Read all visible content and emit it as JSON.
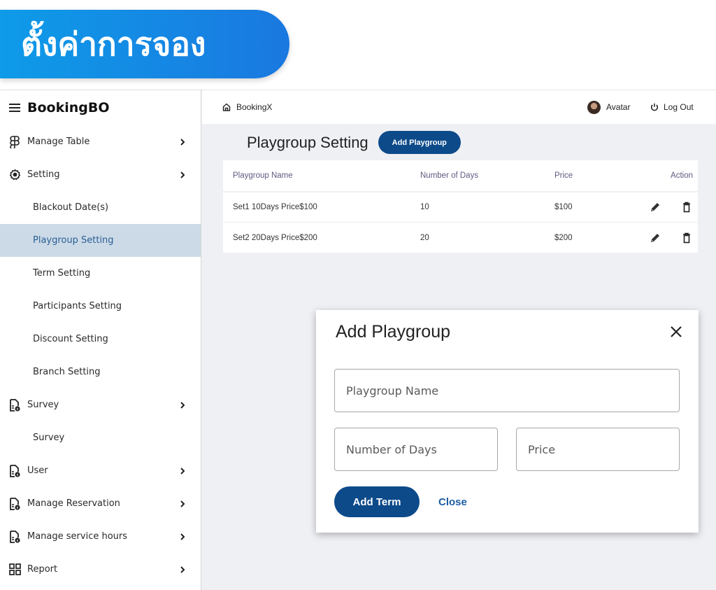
{
  "banner": {
    "title": "ตั้งค่าการจอง"
  },
  "sidebar": {
    "brand": "BookingBO",
    "items": [
      {
        "label": "Manage Table",
        "icon": "figma-icon",
        "level": "top",
        "chevron": true
      },
      {
        "label": "Setting",
        "icon": "gear-icon",
        "level": "top",
        "chevron": true
      },
      {
        "label": "Blackout Date(s)",
        "level": "sub"
      },
      {
        "label": "Playgroup Setting",
        "level": "sub",
        "active": true
      },
      {
        "label": "Term Setting",
        "level": "sub"
      },
      {
        "label": "Participants Setting",
        "level": "sub"
      },
      {
        "label": "Discount Setting",
        "level": "sub"
      },
      {
        "label": "Branch Setting",
        "level": "sub"
      },
      {
        "label": "Survey",
        "icon": "document-info-icon",
        "level": "top",
        "chevron": true
      },
      {
        "label": "Survey",
        "level": "sub"
      },
      {
        "label": "User",
        "icon": "document-info-icon",
        "level": "top",
        "chevron": true
      },
      {
        "label": "Manage Reservation",
        "icon": "document-info-icon",
        "level": "top",
        "chevron": true
      },
      {
        "label": "Manage service hours",
        "icon": "document-info-icon",
        "level": "top",
        "chevron": true
      },
      {
        "label": "Report",
        "icon": "grid-icon",
        "level": "top",
        "chevron": true
      }
    ]
  },
  "topbar": {
    "breadcrumb": "BookingX",
    "user": "Avatar",
    "logout": "Log Out"
  },
  "page": {
    "title": "Playgroup Setting",
    "add_button": "Add Playgroup"
  },
  "table": {
    "columns": [
      "Playgroup Name",
      "Number of Days",
      "Price",
      "Action"
    ],
    "rows": [
      {
        "name": "Set1 10Days Price$100",
        "days": "10",
        "price": "$100"
      },
      {
        "name": "Set2 20Days Price$200",
        "days": "20",
        "price": "$200"
      }
    ]
  },
  "dialog": {
    "title": "Add Playgroup",
    "fields": {
      "name_placeholder": "Playgroup Name",
      "days_placeholder": "Number of Days",
      "price_placeholder": "Price"
    },
    "submit": "Add Term",
    "close": "Close"
  },
  "colors": {
    "primary": "#0c4a8a",
    "active_nav_bg": "#cbdae6",
    "active_nav_text": "#2a5d95",
    "main_bg": "#eff0f4",
    "banner_start": "#0e9be8",
    "banner_end": "#1a78e0"
  }
}
